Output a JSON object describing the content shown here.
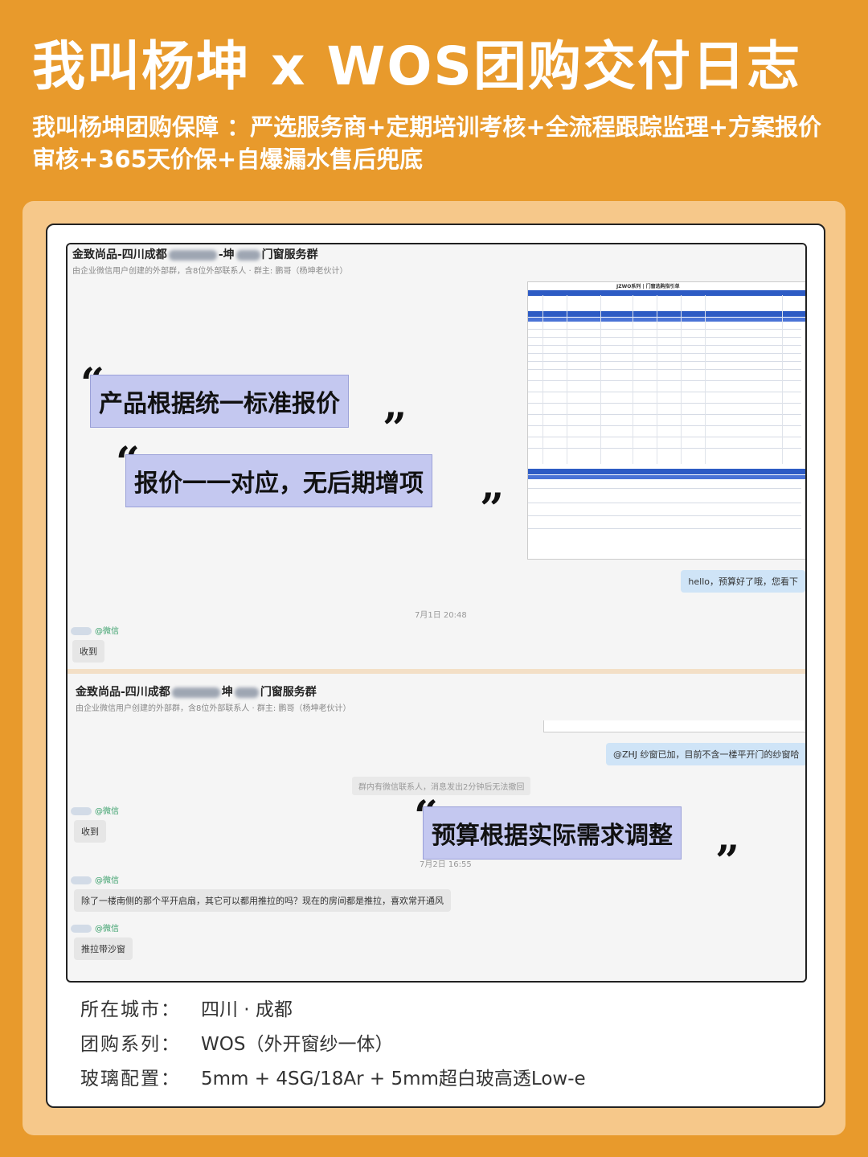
{
  "header": {
    "title": "我叫杨坤 x WOS团购交付日志",
    "subtitle": "我叫杨坤团购保障 ：严选服务商+定期培训考核+全流程跟踪监理+方案报价审核+365天价保+自爆漏水售后兜底"
  },
  "chat1": {
    "group_name_prefix": "金致尚品-四川成都",
    "group_name_mid": "-坤",
    "group_name_suffix": "门窗服务群",
    "group_meta": "由企业微信用户创建的外部群，含8位外部联系人 · 群主: 鹏哥（杨坤老伙计）",
    "sheet_title": "JZWO系列 | 门窗选购指引单",
    "msg_right": "hello，预算好了哦，您看下",
    "timestamp": "7月1日 20:48",
    "sender": "@微信",
    "reply": "收到"
  },
  "chat2": {
    "group_name_prefix": "金致尚品-四川成都",
    "group_name_mid": "坤",
    "group_name_suffix": "门窗服务群",
    "group_meta": "由企业微信用户创建的外部群，含8位外部联系人 · 群主: 鹏哥（杨坤老伙计）",
    "msg_right": "@ZHJ 纱窗已加，目前不含一楼平开门的纱窗哈",
    "system": "群内有微信联系人，消息发出2分钟后无法撤回",
    "sender1": "@微信",
    "reply1": "收到",
    "timestamp": "7月2日 16:55",
    "sender2": "@微信",
    "msg_long": "除了一楼南侧的那个平开启扇，其它可以都用推拉的吗？现在的房间都是推拉，喜欢常开通风",
    "sender3": "@微信",
    "msg_short": "推拉带沙窗"
  },
  "quotes": {
    "q1": "产品根据统一标准报价",
    "q2": "报价一一对应，无后期增项",
    "q3": "预算根据实际需求调整"
  },
  "info": [
    {
      "key": "所在城市：",
      "value": "四川 · 成都"
    },
    {
      "key": "团购系列：",
      "value": "WOS（外开窗纱一体）"
    },
    {
      "key": "玻璃配置：",
      "value": "5mm + 4SG/18Ar + 5mm超白玻高透Low-e"
    }
  ]
}
